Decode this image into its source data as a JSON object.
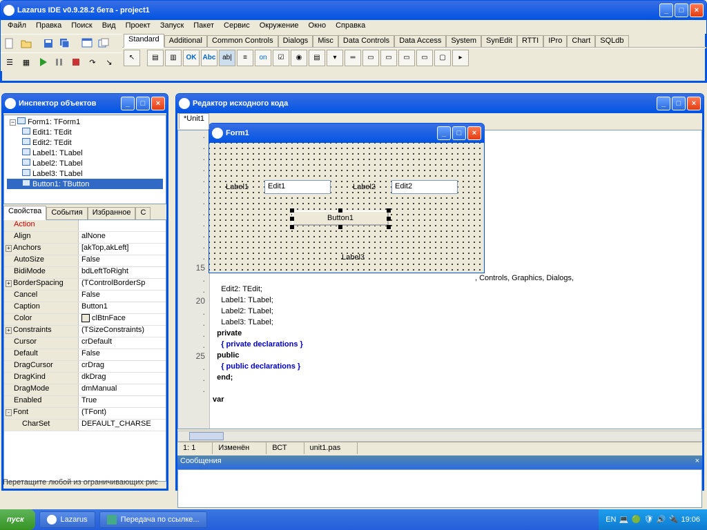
{
  "ide": {
    "title": "Lazarus IDE v0.9.28.2 бета - project1",
    "menus": [
      "Файл",
      "Правка",
      "Поиск",
      "Вид",
      "Проект",
      "Запуск",
      "Пакет",
      "Сервис",
      "Окружение",
      "Окно",
      "Справка"
    ],
    "tabs": [
      "Standard",
      "Additional",
      "Common Controls",
      "Dialogs",
      "Misc",
      "Data Controls",
      "Data Access",
      "System",
      "SynEdit",
      "RTTI",
      "IPro",
      "Chart",
      "SQLdb"
    ]
  },
  "inspector": {
    "title": "Инспектор объектов",
    "tree": [
      {
        "label": "Form1: TForm1",
        "level": 0,
        "isParent": true,
        "sel": false
      },
      {
        "label": "Edit1: TEdit",
        "level": 1,
        "sel": false
      },
      {
        "label": "Edit2: TEdit",
        "level": 1,
        "sel": false
      },
      {
        "label": "Label1: TLabel",
        "level": 1,
        "sel": false
      },
      {
        "label": "Label2: TLabel",
        "level": 1,
        "sel": false
      },
      {
        "label": "Label3: TLabel",
        "level": 1,
        "sel": false
      },
      {
        "label": "Button1: TButton",
        "level": 1,
        "sel": true
      }
    ],
    "pg_tabs": [
      "Свойства",
      "События",
      "Избранное",
      "С"
    ],
    "props": [
      {
        "k": "Action",
        "v": "",
        "action": true
      },
      {
        "k": "Align",
        "v": "alNone"
      },
      {
        "k": "Anchors",
        "v": "[akTop,akLeft]",
        "exp": "+"
      },
      {
        "k": "AutoSize",
        "v": "False"
      },
      {
        "k": "BidiMode",
        "v": "bdLeftToRight"
      },
      {
        "k": "BorderSpacing",
        "v": "(TControlBorderSp",
        "exp": "+"
      },
      {
        "k": "Cancel",
        "v": "False"
      },
      {
        "k": "Caption",
        "v": "Button1"
      },
      {
        "k": "Color",
        "v": "clBtnFace",
        "swatch": "#ece9d8"
      },
      {
        "k": "Constraints",
        "v": "(TSizeConstraints)",
        "exp": "+"
      },
      {
        "k": "Cursor",
        "v": "crDefault"
      },
      {
        "k": "Default",
        "v": "False"
      },
      {
        "k": "DragCursor",
        "v": "crDrag"
      },
      {
        "k": "DragKind",
        "v": "dkDrag"
      },
      {
        "k": "DragMode",
        "v": "dmManual"
      },
      {
        "k": "Enabled",
        "v": "True"
      },
      {
        "k": "Font",
        "v": "(TFont)",
        "exp": "-"
      },
      {
        "k": "CharSet",
        "v": "DEFAULT_CHARSE",
        "indent": true
      }
    ]
  },
  "source": {
    "title": "Редактор исходного кода",
    "tab": "*Unit1",
    "status": {
      "pos": "1: 1",
      "mod": "Изменён",
      "ins": "ВСТ",
      "file": "unit1.pas"
    },
    "messages_title": "Сообщения",
    "visible_uses_tail": ", Controls, Graphics, Dialogs,",
    "lines": [
      {
        "n": "",
        "t": "    Edit2: TEdit;"
      },
      {
        "n": "",
        "t": "    Label1: TLabel;"
      },
      {
        "n": "20",
        "t": "    Label2: TLabel;"
      },
      {
        "n": "",
        "t": "    Label3: TLabel;"
      },
      {
        "n": "",
        "t": "  private",
        "kw": true
      },
      {
        "n": "",
        "t": "    { private declarations }",
        "cmt": true
      },
      {
        "n": "",
        "t": "  public",
        "kw": true
      },
      {
        "n": "25",
        "t": "    { public declarations }",
        "cmt": true
      },
      {
        "n": "",
        "t": "  end;",
        "kw": true
      },
      {
        "n": "",
        "t": ""
      },
      {
        "n": "",
        "t": "var",
        "kw": true
      }
    ]
  },
  "form": {
    "title": "Form1",
    "label1": "Label1",
    "label2": "Label2",
    "label3": "Label3",
    "edit1": "Edit1",
    "edit2": "Edit2",
    "button1": "Button1",
    "gutter_nums": [
      "",
      "",
      "",
      "",
      "",
      "",
      "",
      "",
      "",
      "15"
    ]
  },
  "hint": "Перетащите любой из ограничивающих рис",
  "taskbar": {
    "start": "пуск",
    "items": [
      "Lazarus",
      "Передача по ссылке..."
    ],
    "lang": "EN",
    "clock": "19:06"
  }
}
